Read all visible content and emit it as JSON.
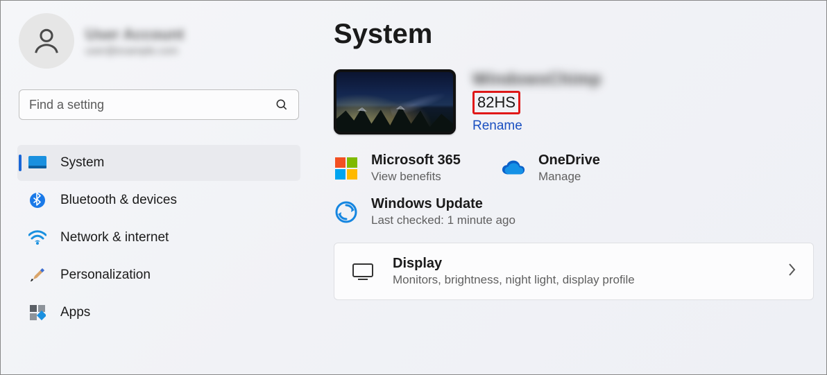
{
  "profile": {
    "name_blurred": "User Account",
    "email_blurred": "user@example.com"
  },
  "search": {
    "placeholder": "Find a setting"
  },
  "sidebar": {
    "items": [
      {
        "label": "System"
      },
      {
        "label": "Bluetooth & devices"
      },
      {
        "label": "Network & internet"
      },
      {
        "label": "Personalization"
      },
      {
        "label": "Apps"
      }
    ]
  },
  "main": {
    "title": "System",
    "device": {
      "name_blurred": "WindowsChimp",
      "model": "82HS",
      "rename_label": "Rename"
    },
    "tiles": {
      "ms365": {
        "title": "Microsoft 365",
        "sub": "View benefits"
      },
      "onedrive": {
        "title": "OneDrive",
        "sub": "Manage"
      },
      "update": {
        "title": "Windows Update",
        "sub": "Last checked: 1 minute ago"
      }
    },
    "cards": {
      "display": {
        "title": "Display",
        "sub": "Monitors, brightness, night light, display profile"
      }
    }
  }
}
